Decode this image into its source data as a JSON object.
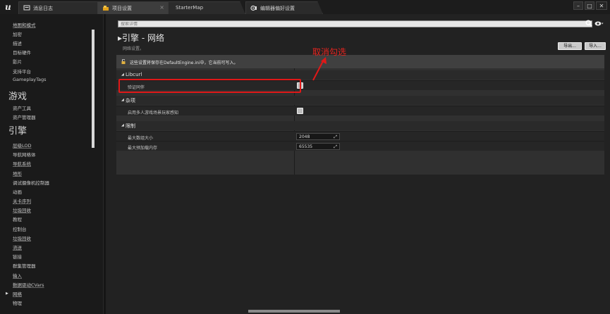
{
  "titlebar": {
    "logo": "u",
    "tabs": [
      {
        "label": "消息日志",
        "icon": "message-log-icon",
        "active": false
      },
      {
        "label": "项目设置",
        "icon": "project-settings-icon",
        "active": true
      },
      {
        "label": "StarterMap",
        "icon": "",
        "active": false
      },
      {
        "label": "编辑器偏好设置",
        "icon": "editor-preferences-icon",
        "active": false
      }
    ],
    "window": {
      "minimize": "–",
      "maximize": "□",
      "close": "✕"
    }
  },
  "sidebar": {
    "items": [
      "地图和模式",
      "加密",
      "描述",
      "目标硬件",
      "影片",
      "支持平台",
      "GameplayTags"
    ],
    "section_game": "游戏",
    "game_items": [
      "资产工具",
      "资产管理器"
    ],
    "section_engine": "引擎",
    "engine_items": [
      "层级LOD",
      "导航网格体",
      "导航系统",
      "地形",
      "调试摄像机控制器",
      "动画",
      "关卡序列",
      "垃圾回收",
      "教程",
      "控制台",
      "垃圾回收",
      "流送",
      "链接",
      "群集管理器",
      "输入",
      "数据驱动CVars",
      "网络",
      "物理"
    ],
    "expanded_item": "网络"
  },
  "search": {
    "placeholder": "搜索详情"
  },
  "page": {
    "title": "引擎 - 网络",
    "subtitle": "网络设置。",
    "export_label": "导出...",
    "import_label": "导入..."
  },
  "notice": {
    "text": "这些设置将保存在DefaultEngine.ini中，它当前可写入。"
  },
  "sections": [
    {
      "label": "Libcurl",
      "rows": [
        {
          "label": "验证同伴",
          "type": "checkbox",
          "checked": false
        }
      ]
    },
    {
      "label": "杂项",
      "rows": [
        {
          "label": "启用多人游戏场景玩家感知",
          "type": "checkbox",
          "checked": false
        }
      ]
    },
    {
      "label": "限制",
      "rows": [
        {
          "label": "最大数组大小",
          "type": "number",
          "value": "2048"
        },
        {
          "label": "最大预加载内存",
          "type": "number",
          "value": "65535"
        }
      ]
    }
  ],
  "annotation": {
    "text": "取消勾选",
    "color": "#e01818"
  },
  "colors": {
    "accent": "#e01818",
    "panel": "#303030",
    "background": "#151515"
  }
}
